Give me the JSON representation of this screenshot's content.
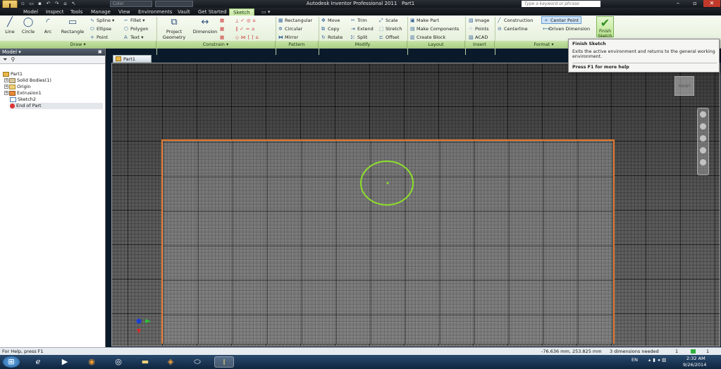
{
  "app": {
    "title": "Autodesk Inventor Professional 2011",
    "document": "Part1",
    "search_placeholder": "Type a keyword or phrase",
    "color_combo": "Color"
  },
  "menu_tabs": [
    "Model",
    "Inspect",
    "Tools",
    "Manage",
    "View",
    "Environments",
    "Vault",
    "Get Started",
    "Sketch"
  ],
  "ribbon": {
    "draw": {
      "panel": "Draw ▾",
      "line": "Line",
      "circle": "Circle",
      "arc": "Arc",
      "rectangle": "Rectangle",
      "spline": "Spline",
      "ellipse": "Ellipse",
      "point": "Point",
      "fillet": "Fillet",
      "polygon": "Polygon",
      "text": "Text"
    },
    "constrain": {
      "panel": "Constrain ▾",
      "project_geometry": "Project Geometry",
      "dimension": "Dimension"
    },
    "pattern": {
      "panel": "Pattern",
      "rectangular": "Rectangular",
      "circular": "Circular",
      "mirror": "Mirror"
    },
    "modify": {
      "panel": "Modify",
      "move": "Move",
      "copy": "Copy",
      "rotate": "Rotate",
      "trim": "Trim",
      "extend": "Extend",
      "split": "Split",
      "scale": "Scale",
      "stretch": "Stretch",
      "offset": "Offset"
    },
    "layout": {
      "panel": "Layout",
      "make_part": "Make Part",
      "make_components": "Make Components",
      "create_block": "Create Block"
    },
    "insert": {
      "panel": "Insert",
      "image": "Image",
      "points": "Points",
      "acad": "ACAD"
    },
    "format": {
      "panel": "Format ▾",
      "construction": "Construction",
      "centerline": "Centerline",
      "center_point": "Center Point",
      "driven_dimension": "Driven Dimension"
    },
    "finish": {
      "label": "Finish Sketch"
    }
  },
  "tooltip": {
    "title": "Finish Sketch",
    "body": "Exits the active environment and returns to the general working environment.",
    "footer": "Press F1 for more help"
  },
  "browser": {
    "title": "Model ▾",
    "nodes": [
      "Part1",
      "Solid Bodies(1)",
      "Origin",
      "Extrusion1",
      "Sketch2",
      "End of Part"
    ]
  },
  "doc_tab": "Part1",
  "viewcube_label": "FRONT",
  "status": {
    "left": "For Help, press F1",
    "coords": "-76.636 mm, 253.825 mm",
    "dims": "3 dimensions needed",
    "n1": "1",
    "n2": "1"
  },
  "taskbar": {
    "lang": "EN",
    "time": "2:32 AM",
    "date": "9/26/2014"
  },
  "colors": {
    "sketch_circle": "#8de02a",
    "face_edge": "#e87a2e",
    "sketch_tab": "#c5e6a0"
  }
}
